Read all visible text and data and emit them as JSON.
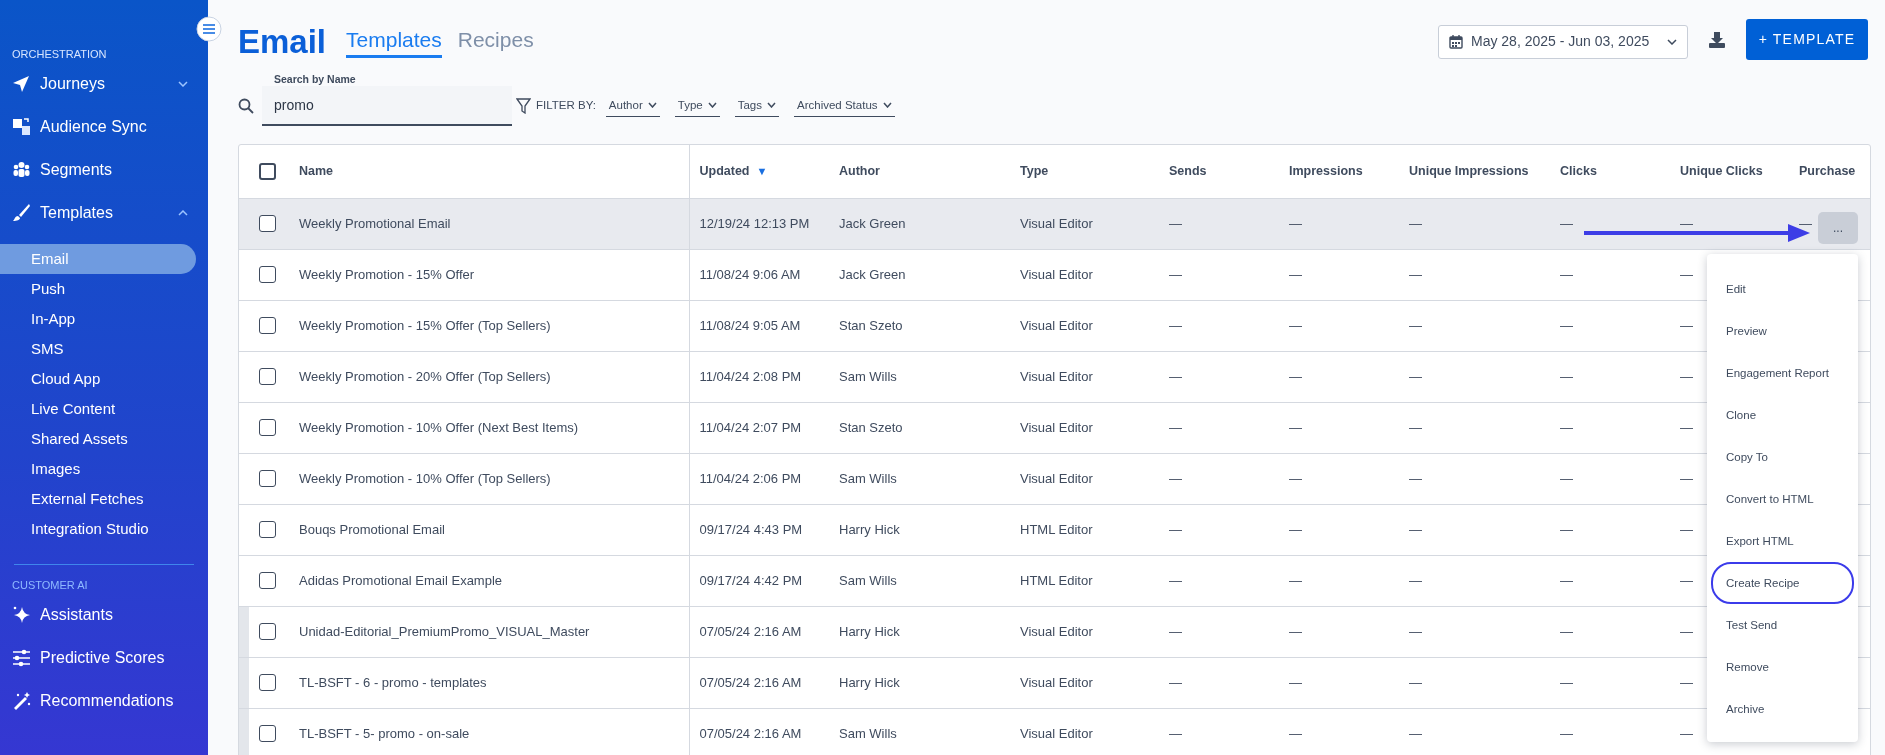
{
  "sidebar": {
    "sections": [
      {
        "title": "ORCHESTRATION",
        "items": [
          {
            "label": "Journeys",
            "expanded": false
          },
          {
            "label": "Audience Sync"
          },
          {
            "label": "Segments"
          },
          {
            "label": "Templates",
            "expanded": true,
            "children": [
              {
                "label": "Email",
                "selected": true
              },
              {
                "label": "Push",
                "selected": false
              },
              {
                "label": "In-App",
                "selected": false
              },
              {
                "label": "SMS",
                "selected": false
              },
              {
                "label": "Cloud App",
                "selected": false
              },
              {
                "label": "Live Content",
                "selected": false
              },
              {
                "label": "Shared Assets",
                "selected": false
              },
              {
                "label": "Images",
                "selected": false
              },
              {
                "label": "External Fetches",
                "selected": false
              },
              {
                "label": "Integration Studio",
                "selected": false
              }
            ]
          }
        ]
      },
      {
        "title": "CUSTOMER AI",
        "items": [
          {
            "label": "Assistants"
          },
          {
            "label": "Predictive Scores"
          },
          {
            "label": "Recommendations"
          }
        ]
      }
    ]
  },
  "header": {
    "title": "Email",
    "tabs": [
      {
        "label": "Templates",
        "selected": true
      },
      {
        "label": "Recipes",
        "selected": false
      }
    ],
    "date_range": "May 28, 2025 - Jun 03, 2025",
    "new_button": "+ TEMPLATE"
  },
  "filters": {
    "search": {
      "label": "Search by Name",
      "value": "promo"
    },
    "filter_label": "FILTER BY:",
    "dropdowns": [
      "Author",
      "Type",
      "Tags",
      "Archived Status"
    ]
  },
  "table": {
    "select_all_checked": false,
    "columns": [
      {
        "label": "Name"
      },
      {
        "label": "Updated",
        "sort_arrow": "▼"
      },
      {
        "label": "Author"
      },
      {
        "label": "Type"
      },
      {
        "label": "Sends"
      },
      {
        "label": "Impressions"
      },
      {
        "label": "Unique Impressions"
      },
      {
        "label": "Clicks"
      },
      {
        "label": "Unique Clicks"
      },
      {
        "label": "Purchase"
      }
    ],
    "rows": [
      {
        "checked": false,
        "highlighted": true,
        "marked": false,
        "cells": [
          "Weekly Promotional Email",
          "12/19/24 12:13 PM",
          "Jack Green",
          "Visual Editor",
          "—",
          "—",
          "—",
          "—",
          "—",
          "—"
        ]
      },
      {
        "checked": false,
        "highlighted": false,
        "marked": false,
        "cells": [
          "Weekly Promotion - 15% Offer",
          "11/08/24 9:06 AM",
          "Jack Green",
          "Visual Editor",
          "—",
          "—",
          "—",
          "—",
          "—"
        ]
      },
      {
        "checked": false,
        "highlighted": false,
        "marked": false,
        "cells": [
          "Weekly Promotion - 15% Offer (Top Sellers)",
          "11/08/24 9:05 AM",
          "Stan Szeto",
          "Visual Editor",
          "—",
          "—",
          "—",
          "—",
          "—"
        ]
      },
      {
        "checked": false,
        "highlighted": false,
        "marked": false,
        "cells": [
          "Weekly Promotion - 20% Offer (Top Sellers)",
          "11/04/24 2:08 PM",
          "Sam Wills",
          "Visual Editor",
          "—",
          "—",
          "—",
          "—",
          "—"
        ]
      },
      {
        "checked": false,
        "highlighted": false,
        "marked": false,
        "cells": [
          "Weekly Promotion - 10% Offer (Next Best Items)",
          "11/04/24 2:07 PM",
          "Stan Szeto",
          "Visual Editor",
          "—",
          "—",
          "—",
          "—",
          "—"
        ]
      },
      {
        "checked": false,
        "highlighted": false,
        "marked": false,
        "cells": [
          "Weekly Promotion - 10% Offer (Top Sellers)",
          "11/04/24 2:06 PM",
          "Sam Wills",
          "Visual Editor",
          "—",
          "—",
          "—",
          "—",
          "—"
        ]
      },
      {
        "checked": false,
        "highlighted": false,
        "marked": false,
        "cells": [
          "Bouqs Promotional Email",
          "09/17/24 4:43 PM",
          "Harry Hick",
          "HTML Editor",
          "—",
          "—",
          "—",
          "—",
          "—"
        ]
      },
      {
        "checked": false,
        "highlighted": false,
        "marked": false,
        "cells": [
          "Adidas Promotional Email Example",
          "09/17/24 4:42 PM",
          "Sam Wills",
          "HTML Editor",
          "—",
          "—",
          "—",
          "—",
          "—"
        ]
      },
      {
        "checked": false,
        "highlighted": false,
        "marked": true,
        "cells": [
          "Unidad-Editorial_PremiumPromo_VISUAL_Master",
          "07/05/24 2:16 AM",
          "Harry Hick",
          "Visual Editor",
          "—",
          "—",
          "—",
          "—",
          "—"
        ]
      },
      {
        "checked": false,
        "highlighted": false,
        "marked": true,
        "cells": [
          "TL-BSFT - 6 - promo - templates",
          "07/05/24 2:16 AM",
          "Harry Hick",
          "Visual Editor",
          "—",
          "—",
          "—",
          "—",
          "—"
        ]
      },
      {
        "checked": false,
        "highlighted": false,
        "marked": true,
        "cells": [
          "TL-BSFT - 5- promo - on-sale",
          "07/05/24 2:16 AM",
          "Sam Wills",
          "Visual Editor",
          "—",
          "—",
          "—",
          "—",
          "—"
        ]
      }
    ]
  },
  "row_menu": {
    "button": "...",
    "arrow_annotation": true,
    "items": [
      {
        "label": "Edit",
        "circled": false
      },
      {
        "label": "Preview",
        "circled": false
      },
      {
        "label": "Engagement Report",
        "circled": false
      },
      {
        "label": "Clone",
        "circled": false
      },
      {
        "label": "Copy To",
        "circled": false
      },
      {
        "label": "Convert to HTML",
        "circled": false
      },
      {
        "label": "Export HTML",
        "circled": false
      },
      {
        "label": "Create Recipe",
        "circled": true
      },
      {
        "label": "Test Send",
        "circled": false
      },
      {
        "label": "Remove",
        "circled": false
      },
      {
        "label": "Archive",
        "circled": false
      }
    ]
  }
}
